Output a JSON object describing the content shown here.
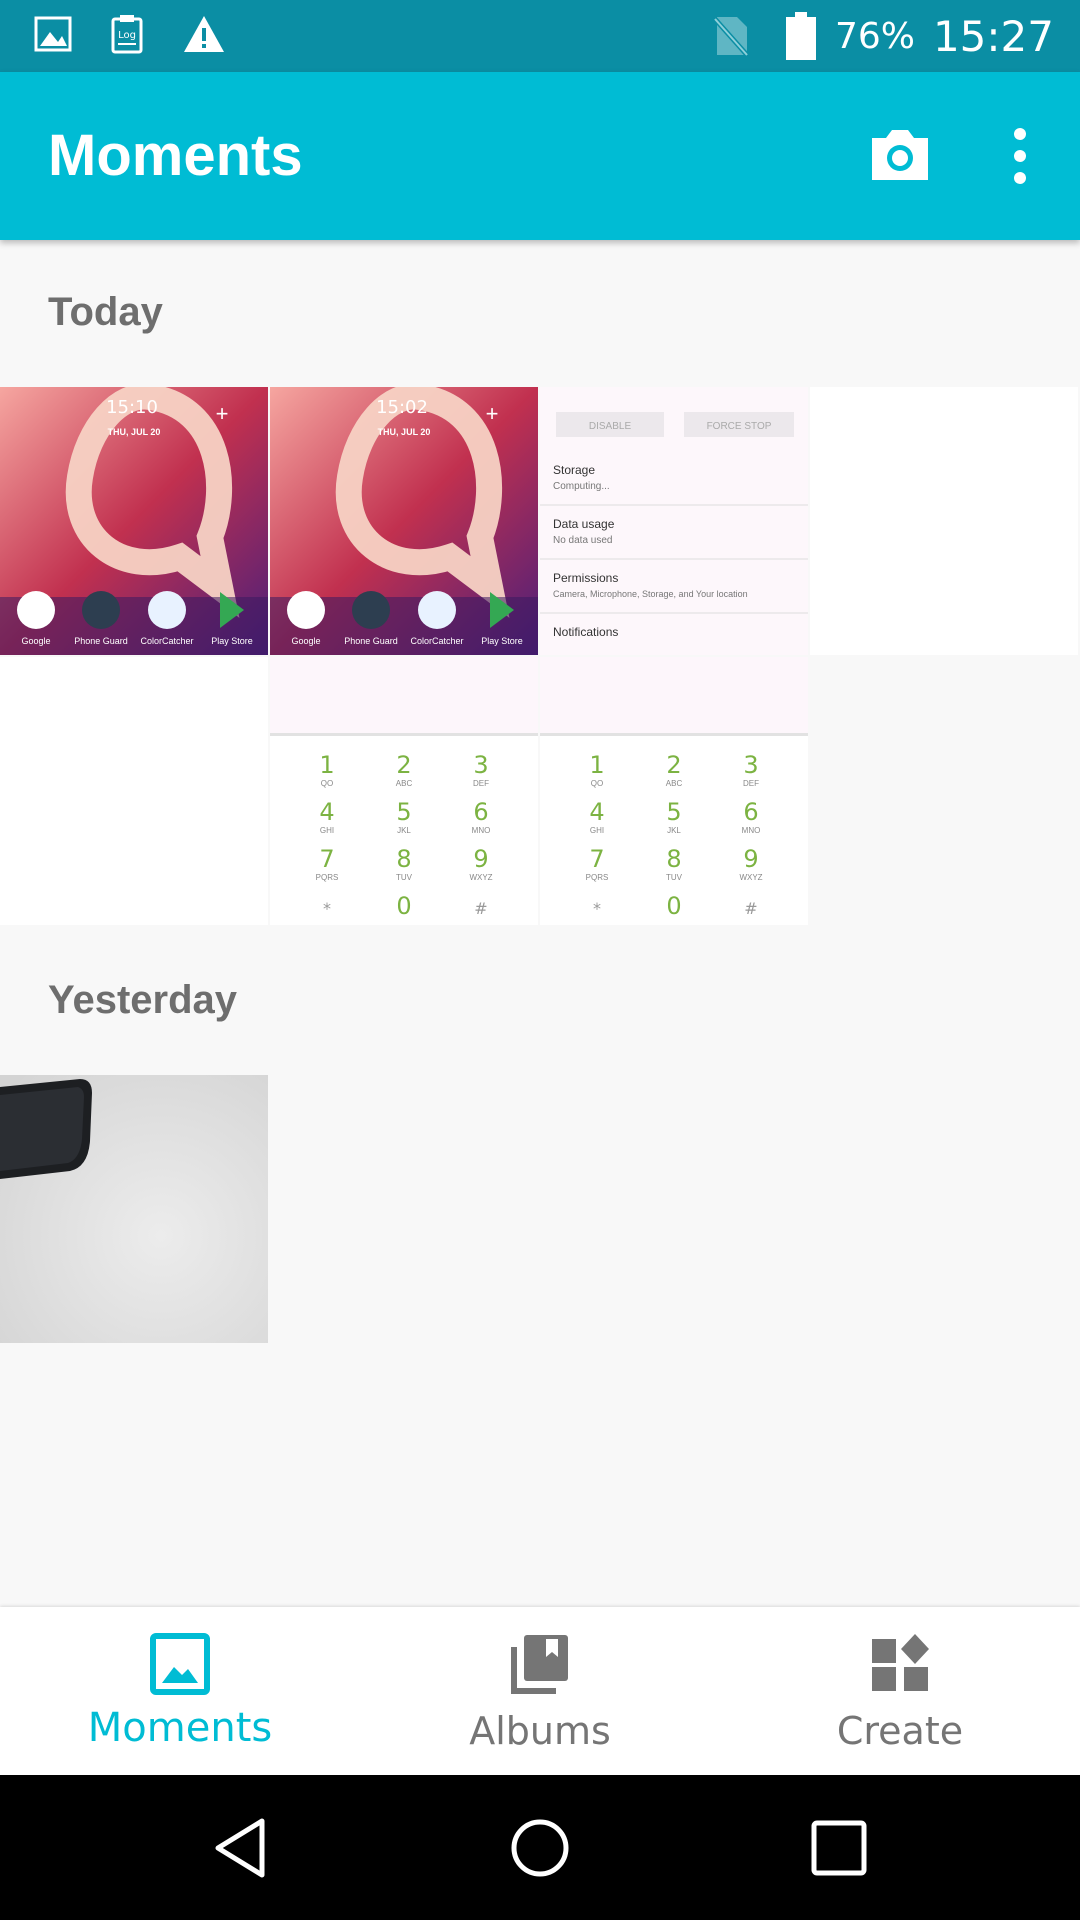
{
  "status_bar": {
    "left_icons": [
      "image-notification-icon",
      "log-notification-icon",
      "warning-icon"
    ],
    "right_icons": [
      "no-sim-icon",
      "battery-icon"
    ],
    "battery_percent": "76%",
    "time": "15:27"
  },
  "app_bar": {
    "title": "Moments",
    "actions": [
      "camera-icon",
      "more-options-icon"
    ]
  },
  "sections": [
    {
      "title": "Today"
    },
    {
      "title": "Yesterday"
    }
  ],
  "thumbnails": {
    "home_screen": {
      "date": "THU, JUL 20",
      "times": [
        "15:10",
        "15:02"
      ],
      "apps": [
        "Google",
        "Phone Guard",
        "ColorCatcher",
        "Play Store"
      ]
    },
    "app_info": {
      "buttons": [
        "DISABLE",
        "FORCE STOP"
      ],
      "rows": [
        {
          "title": "Storage",
          "subtitle": "Computing..."
        },
        {
          "title": "Data usage",
          "subtitle": "No data used"
        },
        {
          "title": "Permissions",
          "subtitle": "Camera, Microphone, Storage, and Your location"
        },
        {
          "title": "Notifications",
          "subtitle": ""
        }
      ]
    },
    "dialpad": {
      "keys": [
        {
          "digit": "1",
          "letters": "QO"
        },
        {
          "digit": "2",
          "letters": "ABC"
        },
        {
          "digit": "3",
          "letters": "DEF"
        },
        {
          "digit": "4",
          "letters": "GHI"
        },
        {
          "digit": "5",
          "letters": "JKL"
        },
        {
          "digit": "6",
          "letters": "MNO"
        },
        {
          "digit": "7",
          "letters": "PQRS"
        },
        {
          "digit": "8",
          "letters": "TUV"
        },
        {
          "digit": "9",
          "letters": "WXYZ"
        },
        {
          "digit": "*",
          "letters": ""
        },
        {
          "digit": "0",
          "letters": ""
        },
        {
          "digit": "#",
          "letters": ""
        }
      ]
    }
  },
  "bottom_nav": {
    "items": [
      {
        "label": "Moments",
        "icon": "moments-icon",
        "active": true
      },
      {
        "label": "Albums",
        "icon": "albums-icon",
        "active": false
      },
      {
        "label": "Create",
        "icon": "create-icon",
        "active": false
      }
    ]
  },
  "system_nav": [
    "back-icon",
    "home-icon",
    "recents-icon"
  ],
  "colors": {
    "accent": "#00bcd4",
    "status_bar": "#0b8ea4",
    "inactive": "#757575",
    "background": "#f8f8f8"
  }
}
